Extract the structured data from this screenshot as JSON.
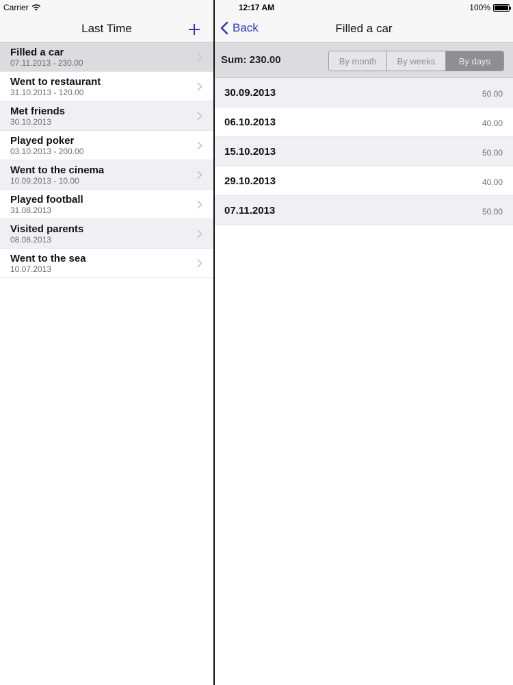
{
  "status_bar": {
    "carrier": "Carrier",
    "time": "12:17 AM",
    "battery": "100%",
    "battery_level": 1.0
  },
  "master": {
    "title": "Last Time",
    "add_icon": "plus-icon",
    "items": [
      {
        "title": "Filled a car",
        "subtitle": "07.11.2013 - 230.00",
        "selected": true
      },
      {
        "title": "Went to restaurant",
        "subtitle": "31.10.2013 - 120.00"
      },
      {
        "title": "Met friends",
        "subtitle": "30.10.2013"
      },
      {
        "title": "Played poker",
        "subtitle": "03.10.2013 - 200.00"
      },
      {
        "title": "Went to the cinema",
        "subtitle": "10.09.2013 - 10.00"
      },
      {
        "title": "Played football",
        "subtitle": "31.08.2013"
      },
      {
        "title": "Visited parents",
        "subtitle": "08.08.2013"
      },
      {
        "title": "Went to the sea",
        "subtitle": "10.07.2013"
      }
    ]
  },
  "detail": {
    "back_label": "Back",
    "title": "Filled a car",
    "sum": "Sum: 230.00",
    "segments": [
      "By month",
      "By weeks",
      "By days"
    ],
    "active_segment": "By days",
    "rows": [
      {
        "date": "30.09.2013",
        "amount": "50.00"
      },
      {
        "date": "06.10.2013",
        "amount": "40.00"
      },
      {
        "date": "15.10.2013",
        "amount": "50.00"
      },
      {
        "date": "29.10.2013",
        "amount": "40.00"
      },
      {
        "date": "07.11.2013",
        "amount": "50.00"
      }
    ]
  },
  "colors": {
    "accent": "#2f3bbb",
    "selected_row": "#dcdcdf",
    "shaded_row": "#efeff4"
  }
}
